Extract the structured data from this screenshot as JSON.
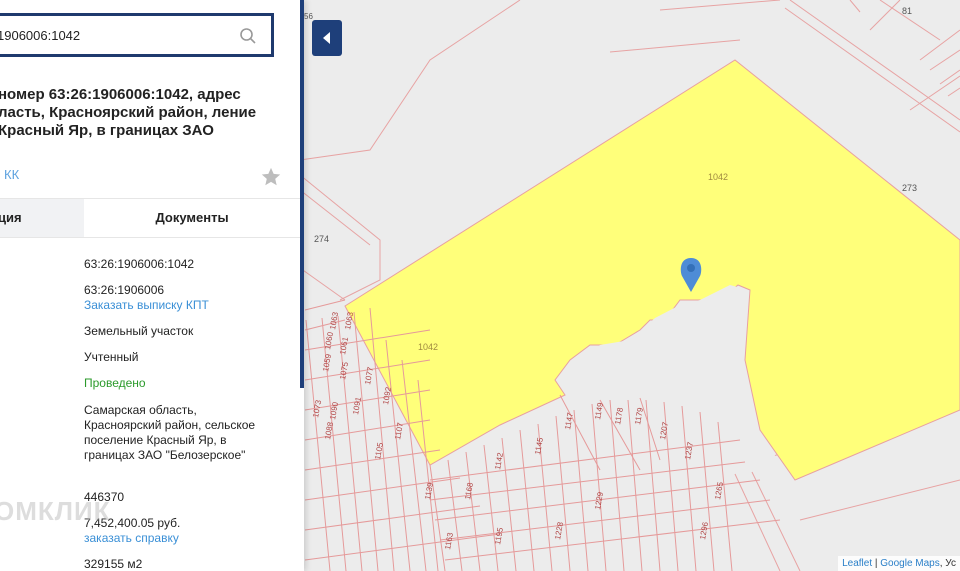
{
  "search": {
    "value": "1906006:1042"
  },
  "info": {
    "title": "номер 63:26:1906006:1042, адрес ласть, Красноярский район, ление Красный Яр, в границах ЗАО",
    "kk_link": "КК"
  },
  "tabs": {
    "left": "ция",
    "right": "Документы"
  },
  "fields": {
    "cadastral_number": "63:26:1906006:1042",
    "quarter": "63:26:1906006",
    "order_kpt": "Заказать выписку КПТ",
    "type": "Земельный участок",
    "status": "Учтенный",
    "check": "Проведено",
    "address": "Самарская область, Красноярский район, сельское поселение Красный Яр, в границах ЗАО \"Белозерское\"",
    "area": "446370",
    "cost": "7,452,400.05 руб.",
    "order_cert": "заказать справку",
    "area_m2": "329155 м2"
  },
  "watermark": "ОМКЛИК",
  "map": {
    "parcel_label_main": "1042",
    "parcel_label_top": "1042",
    "parcel_numbers": [
      "81",
      "273",
      "274",
      "56"
    ],
    "attribution": {
      "leaflet": "Leaflet",
      "sep": " | ",
      "google": "Google Maps",
      "rest": ", Ус"
    }
  },
  "colors": {
    "accent": "#1e3f7a",
    "parcel_fill": "#ffff80",
    "parcel_line": "#e8a0a0"
  }
}
